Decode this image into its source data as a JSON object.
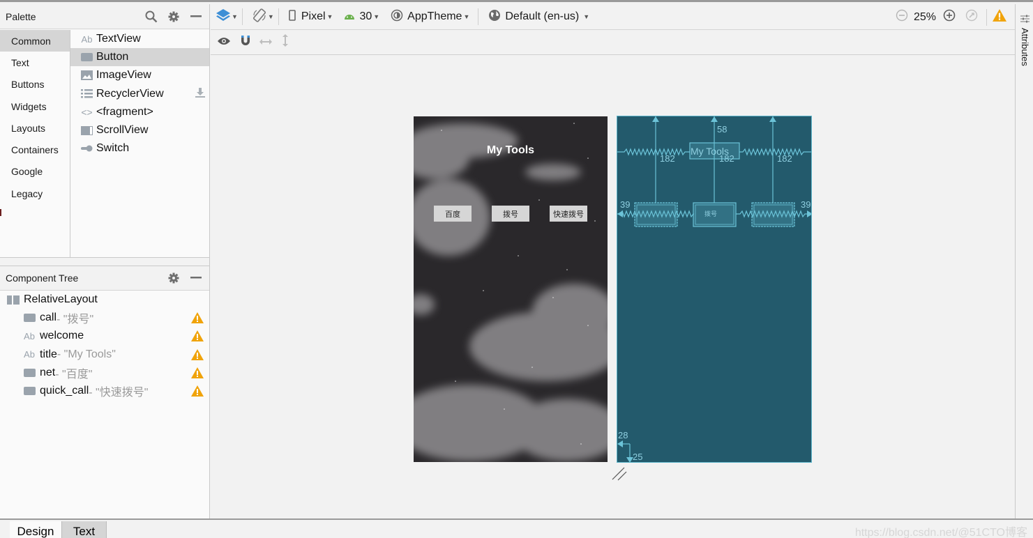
{
  "palette": {
    "title": "Palette",
    "categories": [
      "Common",
      "Text",
      "Buttons",
      "Widgets",
      "Layouts",
      "Containers",
      "Google",
      "Legacy"
    ],
    "active_category": "Common",
    "widgets": [
      {
        "label": "TextView",
        "icon": "textview-icon"
      },
      {
        "label": "Button",
        "icon": "button-icon",
        "selected": true
      },
      {
        "label": "ImageView",
        "icon": "imageview-icon"
      },
      {
        "label": "RecyclerView",
        "icon": "list-icon",
        "download": true
      },
      {
        "label": "<fragment>",
        "icon": "code-brackets-icon"
      },
      {
        "label": "ScrollView",
        "icon": "scrollview-icon"
      },
      {
        "label": "Switch",
        "icon": "switch-icon"
      }
    ]
  },
  "component_tree": {
    "title": "Component Tree",
    "root": "RelativeLayout",
    "items": [
      {
        "id": "call",
        "text": "- \"拨号\"",
        "type": "button",
        "warning": true
      },
      {
        "id": "welcome",
        "text": "",
        "type": "textview",
        "warning": true
      },
      {
        "id": "title",
        "text": "- \"My Tools\"",
        "type": "textview",
        "warning": true
      },
      {
        "id": "net",
        "text": "- \"百度\"",
        "type": "button",
        "warning": true
      },
      {
        "id": "quick_call",
        "text": "- \"快速拨号\"",
        "type": "button",
        "warning": true
      }
    ]
  },
  "toolbar": {
    "device": "Pixel",
    "api": "30",
    "theme": "AppTheme",
    "locale": "Default (en-us)",
    "zoom": "25%"
  },
  "preview": {
    "title": "My Tools",
    "buttons": [
      "百度",
      "拨号",
      "快速拨号"
    ]
  },
  "blueprint": {
    "title": "My Tools",
    "center_button": "拨号",
    "margins": {
      "top": "58",
      "left_right": "39",
      "vertical": "182",
      "bottom_left": "28",
      "bottom": "25"
    }
  },
  "right_panel": {
    "label": "Attributes"
  },
  "bottom_tabs": {
    "design": "Design",
    "text": "Text"
  },
  "watermark": "https://blog.csdn.net/@51CTO博客",
  "colors": {
    "blueprint_bg": "#235a6c",
    "blueprint_line": "#5fb7cc",
    "warning": "#f0a30a",
    "accent_blue": "#3d8fd6"
  }
}
